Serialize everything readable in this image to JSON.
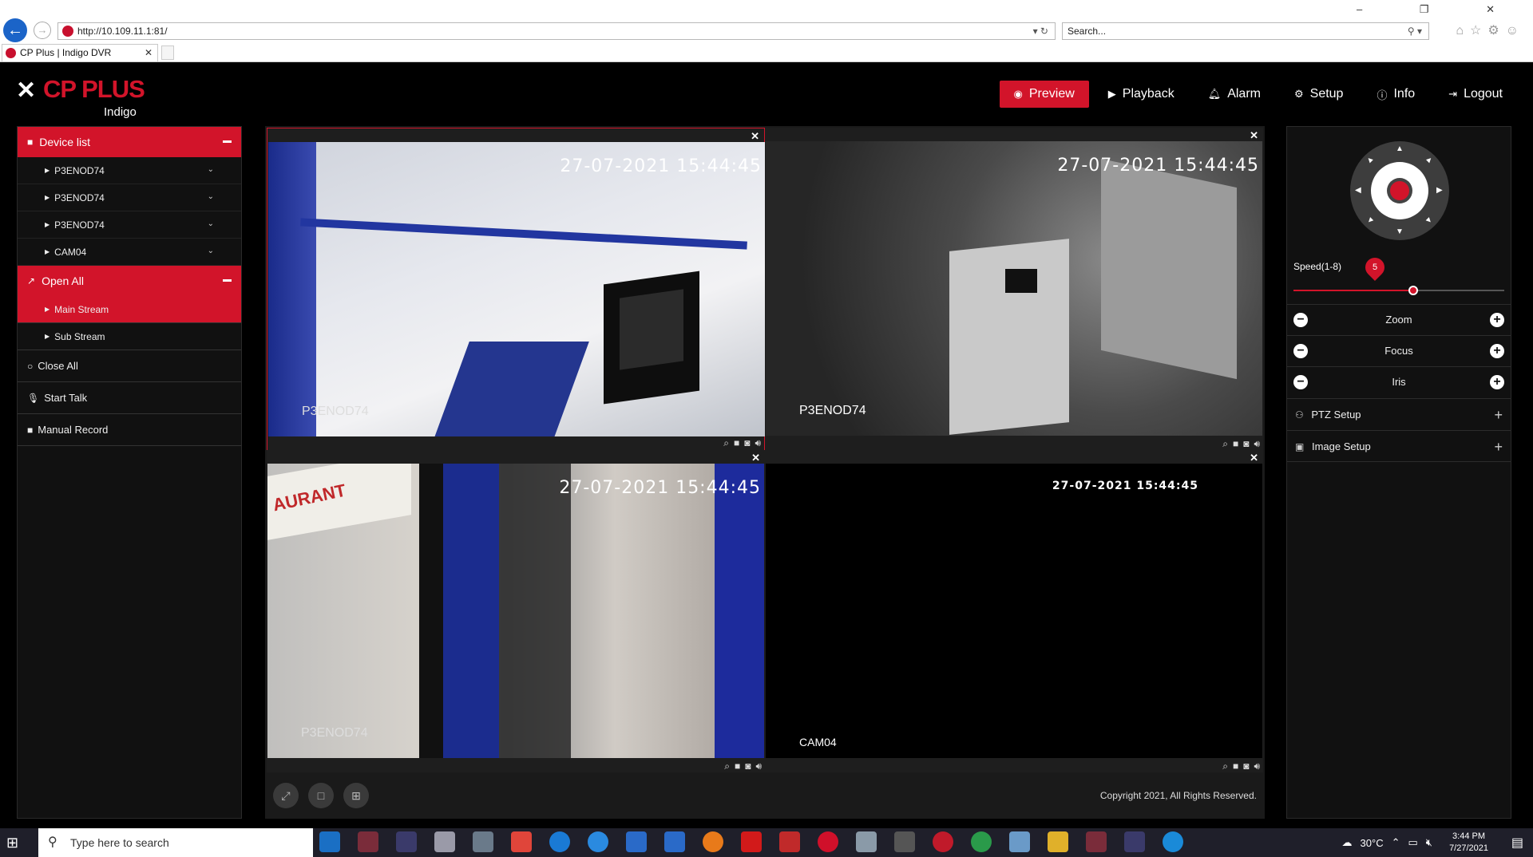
{
  "browser": {
    "url": "http://10.109.11.1:81/",
    "search_placeholder": "Search...",
    "tab_title": "CP Plus | Indigo DVR",
    "window_controls": "–  ❐  ✕"
  },
  "app": {
    "brand": "CP PLUS",
    "brand_sub": "Indigo",
    "nav": [
      {
        "label": "Preview",
        "icon": "eye-icon",
        "active": true
      },
      {
        "label": "Playback",
        "icon": "play-icon"
      },
      {
        "label": "Alarm",
        "icon": "bell-icon"
      },
      {
        "label": "Setup",
        "icon": "gear-icon"
      },
      {
        "label": "Info",
        "icon": "info-icon"
      },
      {
        "label": "Logout",
        "icon": "logout-icon"
      }
    ]
  },
  "left": {
    "device_list_label": "Device list",
    "devices": [
      "P3ENOD74",
      "P3ENOD74",
      "P3ENOD74",
      "CAM04"
    ],
    "open_all_label": "Open All",
    "streams": [
      {
        "label": "Main Stream",
        "active": true
      },
      {
        "label": "Sub Stream",
        "active": false
      }
    ],
    "actions": [
      {
        "label": "Close All",
        "icon": "circle-icon"
      },
      {
        "label": "Start Talk",
        "icon": "mic-icon"
      },
      {
        "label": "Manual Record",
        "icon": "record-icon"
      }
    ]
  },
  "videos": [
    {
      "timestamp": "27-07-2021 15:44:45",
      "camera": "P3ENOD74",
      "scene": "scene1"
    },
    {
      "timestamp": "27-07-2021 15:44:45",
      "camera": "P3ENOD74",
      "scene": "scene2"
    },
    {
      "timestamp": "27-07-2021 15:44:45",
      "camera": "P3ENOD74",
      "scene": "scene3"
    },
    {
      "timestamp": "27-07-2021 15:44:45",
      "camera": "CAM04",
      "scene": "scene4"
    }
  ],
  "scene3_sign": "AURANT",
  "copyright": "Copyright 2021, All Rights Reserved.",
  "ptz": {
    "speed_label": "Speed(1-8)",
    "speed_value": "5",
    "speed_fraction": 0.57,
    "controls": [
      "Zoom",
      "Focus",
      "Iris"
    ],
    "setup": [
      {
        "label": "PTZ Setup",
        "icon": "gamepad-icon"
      },
      {
        "label": "Image Setup",
        "icon": "image-icon"
      }
    ]
  },
  "taskbar": {
    "search_placeholder": "Type here to search",
    "weather": "30°C",
    "time": "3:44 PM",
    "date": "7/27/2021"
  },
  "colors": {
    "accent": "#d2142a",
    "background": "#000000",
    "panel": "#111111"
  }
}
